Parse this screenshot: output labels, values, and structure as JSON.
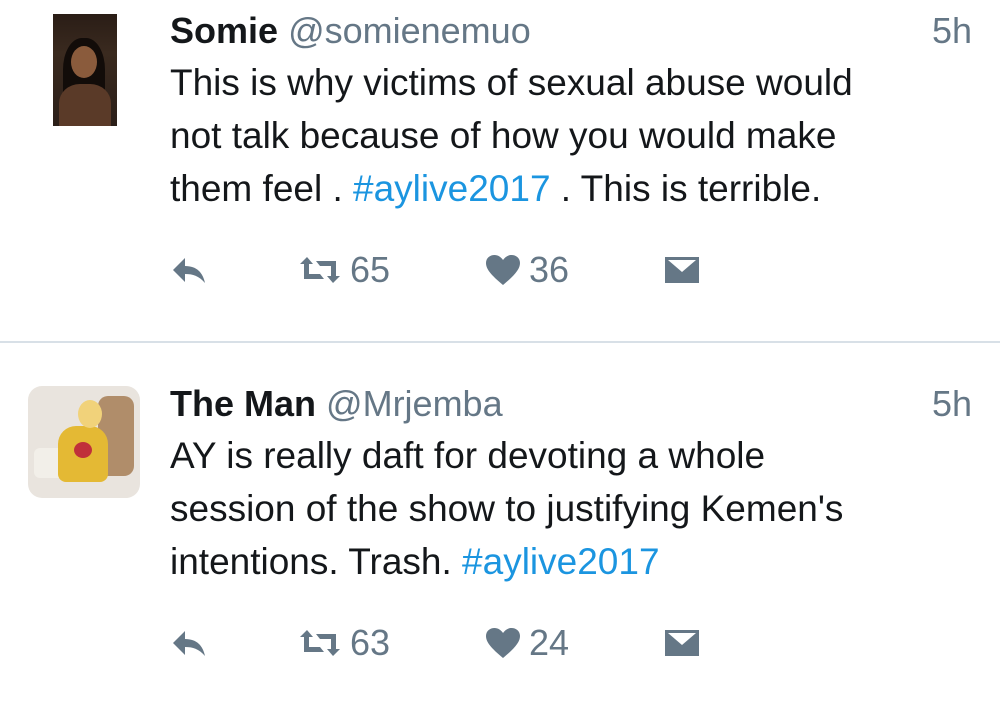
{
  "tweets": [
    {
      "author_name": "Somie",
      "handle": "@somienemuo",
      "time": "5h",
      "text_lines": [
        [
          {
            "t": "This is why victims of sexual abuse would",
            "tag": false
          }
        ],
        [
          {
            "t": "not talk because of how you would make",
            "tag": false
          }
        ],
        [
          {
            "t": "them feel . ",
            "tag": false
          },
          {
            "t": "#aylive2017",
            "tag": true
          },
          {
            "t": " . This is terrible.",
            "tag": false
          }
        ]
      ],
      "retweets": "65",
      "likes": "36"
    },
    {
      "author_name": "The Man",
      "handle": "@Mrjemba",
      "time": "5h",
      "text_lines": [
        [
          {
            "t": "AY is really daft for devoting a whole",
            "tag": false
          }
        ],
        [
          {
            "t": "session of the show to justifying Kemen's",
            "tag": false
          }
        ],
        [
          {
            "t": "intentions. Trash. ",
            "tag": false
          },
          {
            "t": "#aylive2017",
            "tag": true
          }
        ]
      ],
      "retweets": "63",
      "likes": "24"
    }
  ],
  "icons": {
    "reply": "reply-icon",
    "retweet": "retweet-icon",
    "like": "heart-icon",
    "message": "envelope-icon"
  },
  "colors": {
    "hashtag": "#1b95e0",
    "secondary_text": "#657786",
    "divider": "#d8e0e7"
  }
}
